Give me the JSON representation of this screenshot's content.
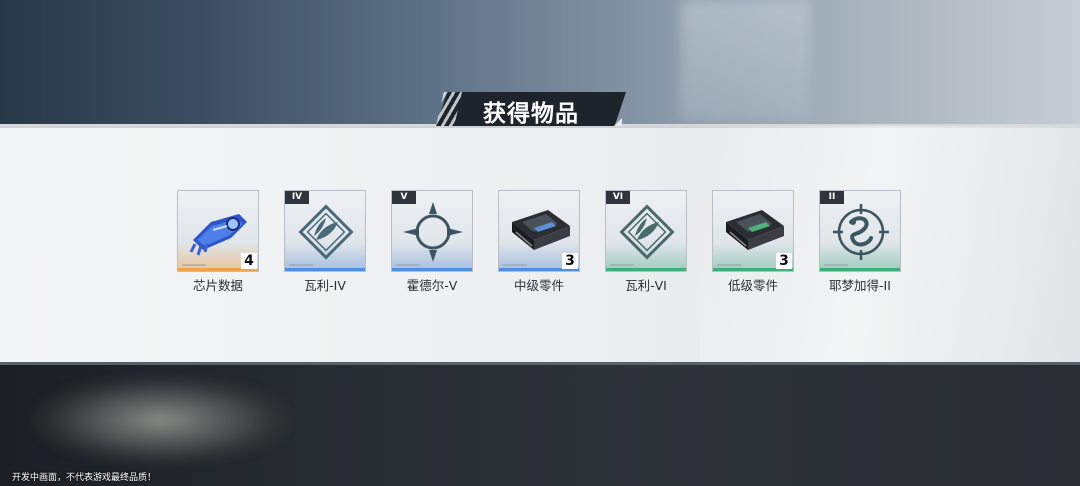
{
  "title": "获得物品",
  "footer_note": "开发中画面，不代表游戏最终品质！",
  "items": [
    {
      "name": "芯片数据",
      "tier": "",
      "quantity": "4",
      "rarity": "orange",
      "icon": "chip-data-icon"
    },
    {
      "name": "瓦利-IV",
      "tier": "IV",
      "quantity": "",
      "rarity": "blue",
      "icon": "leaf-emblem-icon"
    },
    {
      "name": "霍德尔-V",
      "tier": "V",
      "quantity": "",
      "rarity": "blue",
      "icon": "crescent-emblem-icon"
    },
    {
      "name": "中级零件",
      "tier": "",
      "quantity": "3",
      "rarity": "blue",
      "icon": "gpu-part-icon"
    },
    {
      "name": "瓦利-VI",
      "tier": "VI",
      "quantity": "",
      "rarity": "green",
      "icon": "leaf-emblem-icon"
    },
    {
      "name": "低级零件",
      "tier": "",
      "quantity": "3",
      "rarity": "green",
      "icon": "gpu-part-icon"
    },
    {
      "name": "耶梦加得-II",
      "tier": "II",
      "quantity": "",
      "rarity": "green",
      "icon": "serpent-emblem-icon"
    }
  ],
  "colors": {
    "orange": "#f0a24a",
    "blue": "#4f8ee0",
    "green": "#3fae7e",
    "panel": "#eef0f1"
  }
}
